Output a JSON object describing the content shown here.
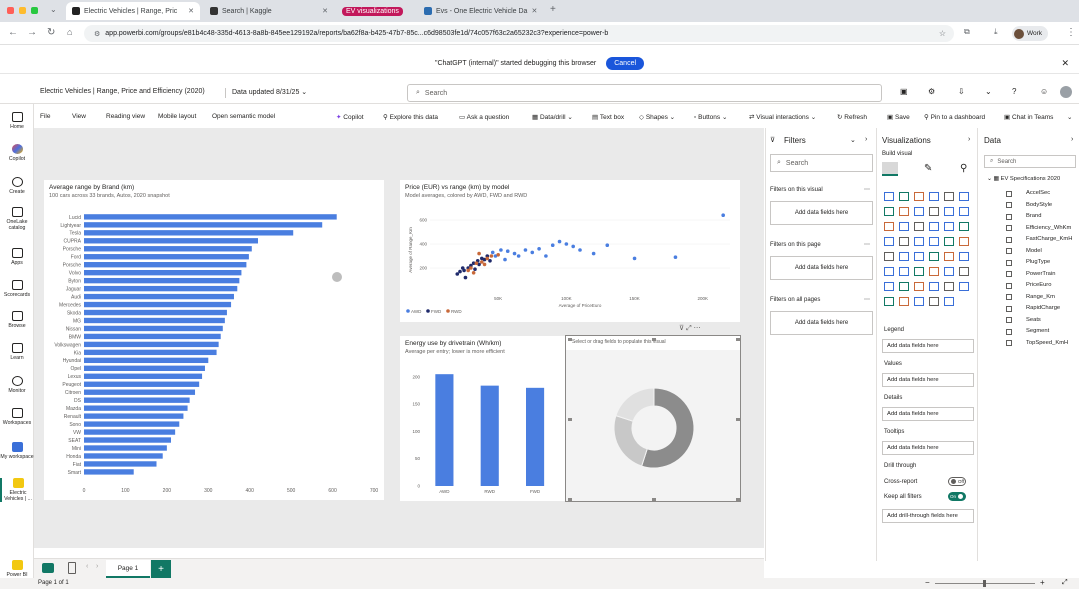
{
  "browser": {
    "tabs": [
      {
        "label": "Electric Vehicles | Range, Pric",
        "active": true
      },
      {
        "label": "Search | Kaggle",
        "active": false
      },
      {
        "label": "EV visualizations",
        "active": false,
        "pill": true
      },
      {
        "label": "Evs - One Electric Vehicle Da",
        "active": false
      }
    ],
    "url": "app.powerbi.com/groups/e81b4c48-335d-4613-8a8b-845ee129192a/reports/ba62f8a-b425-47b7-85c...c6d98503fe1d/74c057f63c2a65232c3?experience=power-b",
    "profile_label": "Work"
  },
  "infobar": {
    "message": "\"ChatGPT (internal)\" started debugging this browser",
    "cancel_label": "Cancel"
  },
  "pbi_header": {
    "report_title": "Electric Vehicles | Range, Price and Efficiency (2020)",
    "data_updated": "Data updated 8/31/25",
    "search_placeholder": "Search"
  },
  "ribbon": {
    "items": [
      "File",
      "View",
      "Reading view",
      "Mobile layout",
      "Open semantic model",
      "Copilot",
      "Explore this data",
      "Ask a question",
      "Data/drill",
      "Text box",
      "Shapes",
      "Buttons",
      "Visual interactions",
      "Refresh",
      "Save",
      "Pin to a dashboard",
      "Chat in Teams"
    ]
  },
  "rail": {
    "items": [
      "Home",
      "Copilot",
      "Create",
      "OneLake catalog",
      "Apps",
      "Scorecards",
      "Browse",
      "Learn",
      "Monitor",
      "Workspaces",
      "My workspace",
      "Electric Vehicles | ..."
    ],
    "bottom": "Power BI"
  },
  "bar_chart": {
    "title": "Average range by Brand (km)",
    "subtitle": "100 cars across 33 brands, Autos, 2020 snapshot",
    "chart_data": {
      "type": "bar",
      "orientation": "horizontal",
      "categories": [
        "Lucid",
        "Lightyear",
        "Tesla",
        "CUPRA",
        "Porsche",
        "Ford",
        "Porsche",
        "Volvo",
        "Byton",
        "Jaguar",
        "Audi",
        "Mercedes",
        "Skoda",
        "MG",
        "Nissan",
        "BMW",
        "Volkswagen",
        "Kia",
        "Hyundai",
        "Opel",
        "Lexus",
        "Peugeot",
        "Citroen",
        "DS",
        "Mazda",
        "Renault",
        "Sono",
        "VW",
        "SEAT",
        "Mini",
        "Honda",
        "Fiat",
        "Smart"
      ],
      "values": [
        610,
        575,
        505,
        420,
        405,
        398,
        392,
        380,
        375,
        370,
        362,
        355,
        345,
        340,
        335,
        330,
        325,
        320,
        300,
        292,
        285,
        278,
        268,
        255,
        250,
        240,
        230,
        220,
        210,
        200,
        190,
        175,
        120
      ],
      "x_ticks": [
        0,
        100,
        200,
        300,
        400,
        500,
        600,
        700
      ],
      "xlim": [
        0,
        700
      ]
    }
  },
  "scatter_chart": {
    "title": "Price (EUR) vs range (km) by model",
    "subtitle": "Model averages, colored by AWD, FWD and RWD",
    "chart_data": {
      "type": "scatter",
      "xlabel": "Average of PriceEuro",
      "ylabel": "Average of Range_Km",
      "x_ticks": [
        "50K",
        "100K",
        "150K",
        "200K"
      ],
      "y_ticks": [
        "200",
        "400",
        "600"
      ],
      "xlim": [
        0,
        220000
      ],
      "ylim": [
        0,
        700
      ],
      "series": [
        {
          "name": "AWD",
          "color": "#4a7ee0",
          "points": [
            [
              57000,
              340
            ],
            [
              62000,
              320
            ],
            [
              70000,
              350
            ],
            [
              80000,
              360
            ],
            [
              90000,
              390
            ],
            [
              100000,
              400
            ],
            [
              110000,
              350
            ],
            [
              120000,
              320
            ],
            [
              130000,
              390
            ],
            [
              150000,
              280
            ],
            [
              180000,
              290
            ],
            [
              215000,
              640
            ],
            [
              65000,
              300
            ],
            [
              75000,
              330
            ],
            [
              85000,
              300
            ],
            [
              95000,
              420
            ],
            [
              105000,
              380
            ],
            [
              55000,
              270
            ],
            [
              48000,
              300
            ],
            [
              52000,
              350
            ],
            [
              46000,
              330
            ]
          ]
        },
        {
          "name": "FWD",
          "color": "#1f2a6b",
          "points": [
            [
              20000,
              150
            ],
            [
              22000,
              170
            ],
            [
              25000,
              180
            ],
            [
              28000,
              200
            ],
            [
              30000,
              220
            ],
            [
              32000,
              240
            ],
            [
              35000,
              260
            ],
            [
              38000,
              280
            ],
            [
              40000,
              270
            ],
            [
              42000,
              300
            ],
            [
              26000,
              120
            ],
            [
              24000,
              200
            ],
            [
              33000,
              190
            ],
            [
              36000,
              230
            ],
            [
              44000,
              260
            ]
          ]
        },
        {
          "name": "RWD",
          "color": "#c8693a",
          "points": [
            [
              30000,
              200
            ],
            [
              34000,
              240
            ],
            [
              38000,
              250
            ],
            [
              42000,
              280
            ],
            [
              45000,
              300
            ],
            [
              28000,
              180
            ],
            [
              36000,
              320
            ],
            [
              50000,
              310
            ],
            [
              40000,
              230
            ],
            [
              32000,
              160
            ]
          ]
        }
      ]
    }
  },
  "column_chart": {
    "title": "Energy use by drivetrain (Wh/km)",
    "subtitle": "Average per entry; lower is more efficient",
    "chart_data": {
      "type": "bar",
      "categories": [
        "AWD",
        "RWD",
        "FWD"
      ],
      "values": [
        205,
        184,
        180
      ],
      "y_ticks": [
        0,
        50,
        100,
        150,
        200
      ],
      "ylim": [
        0,
        220
      ]
    }
  },
  "donut_visual": {
    "placeholder": "Select or drag fields to populate this visual",
    "chart_data": {
      "type": "pie",
      "hole": true,
      "values": [
        55,
        25,
        20
      ],
      "colors": [
        "#8c8c8c",
        "#c8c8c8",
        "#e0e0e0"
      ]
    }
  },
  "filters_pane": {
    "title": "Filters",
    "search_placeholder": "Search",
    "sections": [
      {
        "label": "Filters on this visual",
        "well": "Add data fields here"
      },
      {
        "label": "Filters on this page",
        "well": "Add data fields here"
      },
      {
        "label": "Filters on all pages",
        "well": "Add data fields here"
      }
    ]
  },
  "viz_pane": {
    "title": "Visualizations",
    "build_label": "Build visual",
    "wells": [
      {
        "label": "Legend",
        "well": "Add data fields here"
      },
      {
        "label": "Values",
        "well": "Add data fields here"
      },
      {
        "label": "Details",
        "well": "Add data fields here"
      },
      {
        "label": "Tooltips",
        "well": "Add data fields here"
      }
    ],
    "drill_label": "Drill through",
    "cross_report_label": "Cross-report",
    "cross_report_state": "Off",
    "keep_filters_label": "Keep all filters",
    "keep_filters_state": "On",
    "drill_well": "Add drill-through fields here"
  },
  "data_pane": {
    "title": "Data",
    "search_placeholder": "Search",
    "table": "EV Specifications 2020",
    "fields": [
      "AccelSec",
      "BodyStyle",
      "Brand",
      "Efficiency_WhKm",
      "FastCharge_KmH",
      "Model",
      "PlugType",
      "PowerTrain",
      "PriceEuro",
      "Range_Km",
      "RapidCharge",
      "Seats",
      "Segment",
      "TopSpeed_KmH"
    ]
  },
  "pagebar": {
    "page_label": "Page 1",
    "add_label": "+"
  },
  "status": {
    "page_count": "Page 1 of 1"
  }
}
